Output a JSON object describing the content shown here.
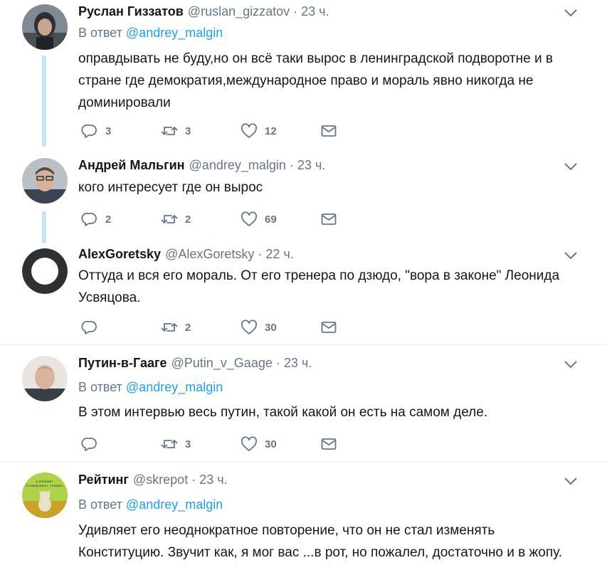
{
  "colors": {
    "link": "#1da1f2",
    "muted": "#657786",
    "text": "#14171a",
    "thread": "#c4e4fa",
    "separator": "#e6ecf0"
  },
  "tweets": [
    {
      "name": "Руслан Гиззатов",
      "handle": "@ruslan_gizzatov",
      "time": "23 ч.",
      "reply_prefix": "В ответ",
      "reply_to": "@andrey_malgin",
      "text": "оправдывать не буду,но он всё таки вырос в ленинградской подворотне и в стране где демократия,международное право и мораль явно никогда не доминировали",
      "replies": "3",
      "retweets": "3",
      "likes": "12",
      "avatar_icon": "user-photo-avatar"
    },
    {
      "name": "Андрей Мальгин",
      "handle": "@andrey_malgin",
      "time": "23 ч.",
      "text": "кого интересует где он вырос",
      "replies": "2",
      "retweets": "2",
      "likes": "69",
      "avatar_icon": "user-photo-avatar"
    },
    {
      "name": "AlexGoretsky",
      "handle": "@AlexGoretsky",
      "time": "22 ч.",
      "text": "Оттуда и вся его мораль. От его тренера по дзюдо, \"вора в законе\" Леонида Усвяцова.",
      "replies": "",
      "retweets": "2",
      "likes": "30",
      "avatar_icon": "ring-avatar"
    },
    {
      "name": "Путин-в-Гааге",
      "handle": "@Putin_v_Gaage",
      "time": "23 ч.",
      "reply_prefix": "В ответ",
      "reply_to": "@andrey_malgin",
      "text": "В этом интервью весь путин, такой какой он есть на самом деле.",
      "replies": "",
      "retweets": "3",
      "likes": "30",
      "avatar_icon": "user-photo-avatar"
    },
    {
      "name": "Рейтинг",
      "handle": "@skrepot",
      "time": "23 ч.",
      "reply_prefix": "В ответ",
      "reply_to": "@andrey_malgin",
      "text": "Удивляет его неоднократное повторение, что он не стал изменять Конституцию. Звучит как, я мог вас ...в рот, но пожалел, достаточно и в жопу.",
      "avatar_icon": "cartoon-cat-avatar",
      "avatar_text": "в спокойн. в совершенн. «покое»"
    }
  ]
}
